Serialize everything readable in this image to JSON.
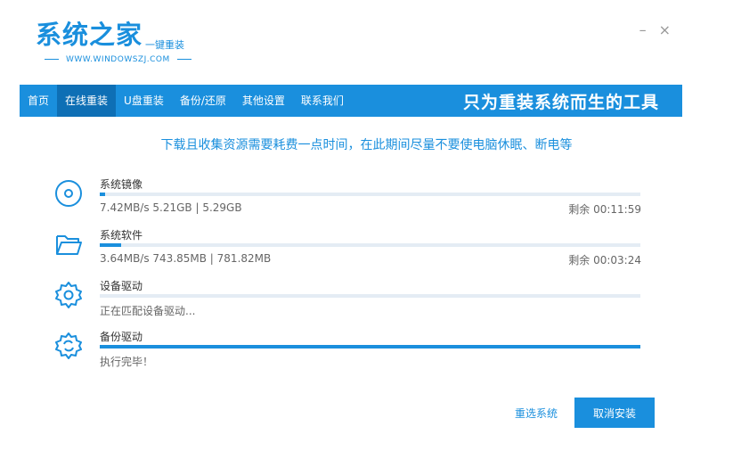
{
  "logo": {
    "title": "系统之家",
    "subtitle": "一键重装",
    "url": "WWW.WINDOWSZJ.COM"
  },
  "window_controls": {
    "minimize": "–",
    "close": "×"
  },
  "nav": {
    "items": [
      {
        "label": "首页"
      },
      {
        "label": "在线重装",
        "active": true
      },
      {
        "label": "U盘重装"
      },
      {
        "label": "备份/还原"
      },
      {
        "label": "其他设置"
      },
      {
        "label": "联系我们"
      }
    ],
    "slogan": "只为重装系统而生的工具"
  },
  "notice": "下载且收集资源需要耗费一点时间，在此期间尽量不要使电脑休眠、断电等",
  "items": [
    {
      "icon": "disc-icon",
      "name": "系统镜像",
      "detail": "7.42MB/s 5.21GB | 5.29GB",
      "remaining": "剩余 00:11:59",
      "progress": 0.01
    },
    {
      "icon": "folder-icon",
      "name": "系统软件",
      "detail": "3.64MB/s 743.85MB | 781.82MB",
      "remaining": "剩余 00:03:24",
      "progress": 0.04
    },
    {
      "icon": "gear-icon",
      "name": "设备驱动",
      "detail": "正在匹配设备驱动...",
      "remaining": "",
      "progress": 0
    },
    {
      "icon": "gear-icon",
      "name": "备份驱动",
      "detail": "执行完毕！",
      "remaining": "",
      "progress": 1
    }
  ],
  "actions": {
    "reselect": "重选系统",
    "cancel": "取消安装"
  },
  "colors": {
    "accent": "#1a8fdd",
    "nav_active": "#0e6fb5"
  }
}
